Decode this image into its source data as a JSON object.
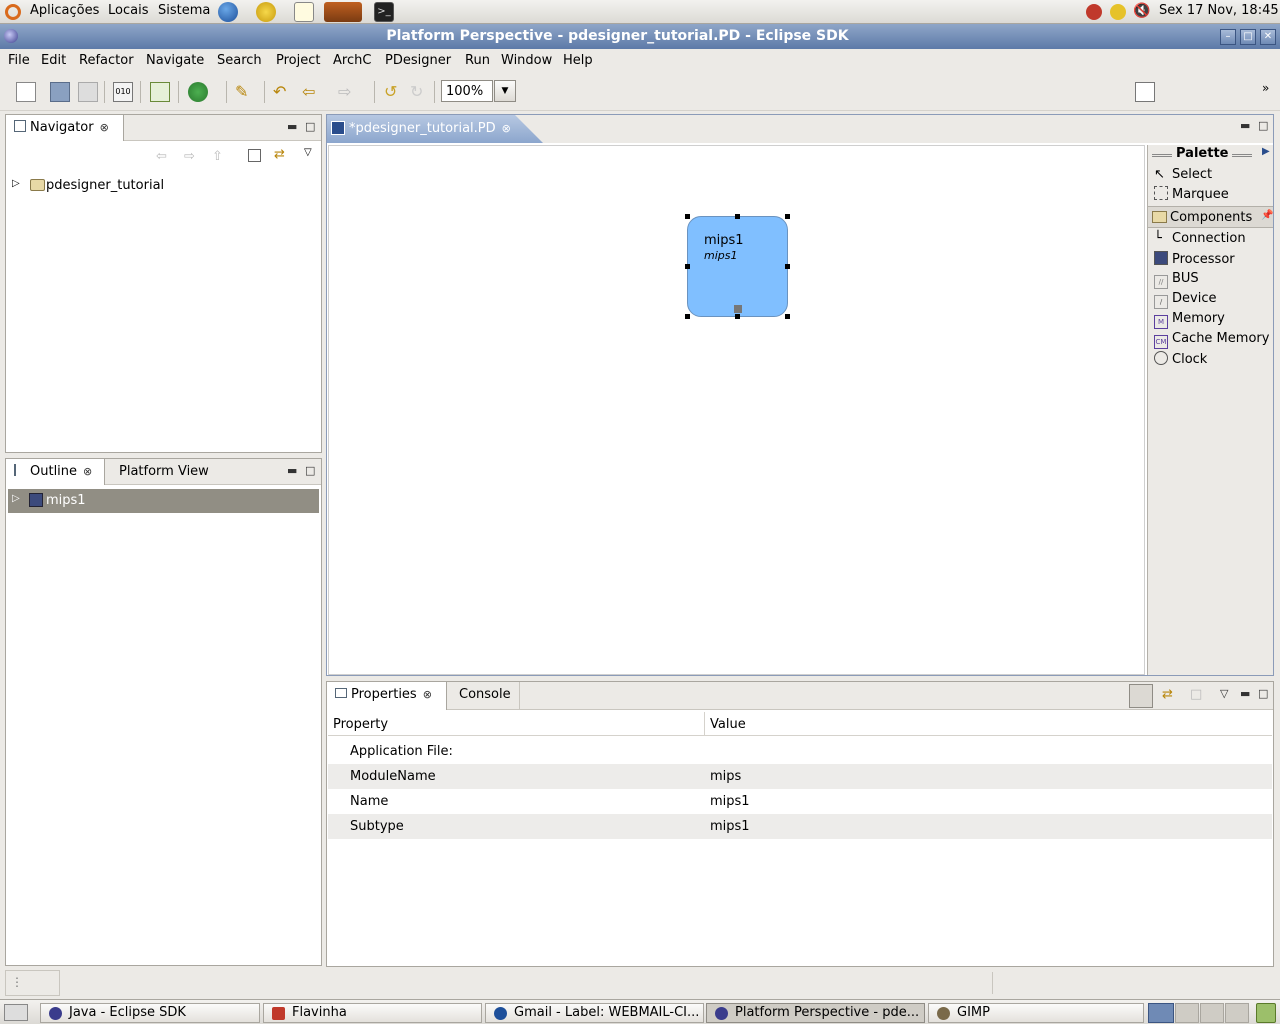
{
  "top_panel": {
    "menus": [
      "Aplicações",
      "Locais",
      "Sistema"
    ],
    "clock": "Sex 17 Nov, 18:45"
  },
  "window": {
    "title": "Platform Perspective - pdesigner_tutorial.PD - Eclipse SDK"
  },
  "menu_bar": [
    "File",
    "Edit",
    "Refactor",
    "Navigate",
    "Search",
    "Project",
    "ArchC",
    "PDesigner",
    "Run",
    "Window",
    "Help"
  ],
  "toolbar": {
    "zoom": "100%"
  },
  "navigator": {
    "tab": "Navigator",
    "tree": [
      "pdesigner_tutorial"
    ]
  },
  "outline": {
    "tab": "Outline",
    "tab2": "Platform View",
    "tree": [
      "mips1"
    ]
  },
  "editor": {
    "tab": "*pdesigner_tutorial.PD",
    "block": {
      "name": "mips1",
      "subtype": "mips1"
    }
  },
  "palette": {
    "title": "Palette",
    "tools": [
      "Select",
      "Marquee"
    ],
    "drawer": "Components",
    "components": [
      "Connection",
      "Processor",
      "BUS",
      "Device",
      "Memory",
      "Cache Memory",
      "Clock"
    ]
  },
  "properties": {
    "tab": "Properties",
    "tab2": "Console",
    "col_property": "Property",
    "col_value": "Value",
    "rows": [
      {
        "property": "Application File:",
        "value": ""
      },
      {
        "property": "ModuleName",
        "value": "mips"
      },
      {
        "property": "Name",
        "value": "mips1"
      },
      {
        "property": "Subtype",
        "value": "mips1"
      }
    ]
  },
  "taskbar": [
    "Java - Eclipse SDK",
    "Flavinha",
    "Gmail - Label: WEBMAIL-CI...",
    "Platform Perspective - pde...",
    "GIMP"
  ]
}
